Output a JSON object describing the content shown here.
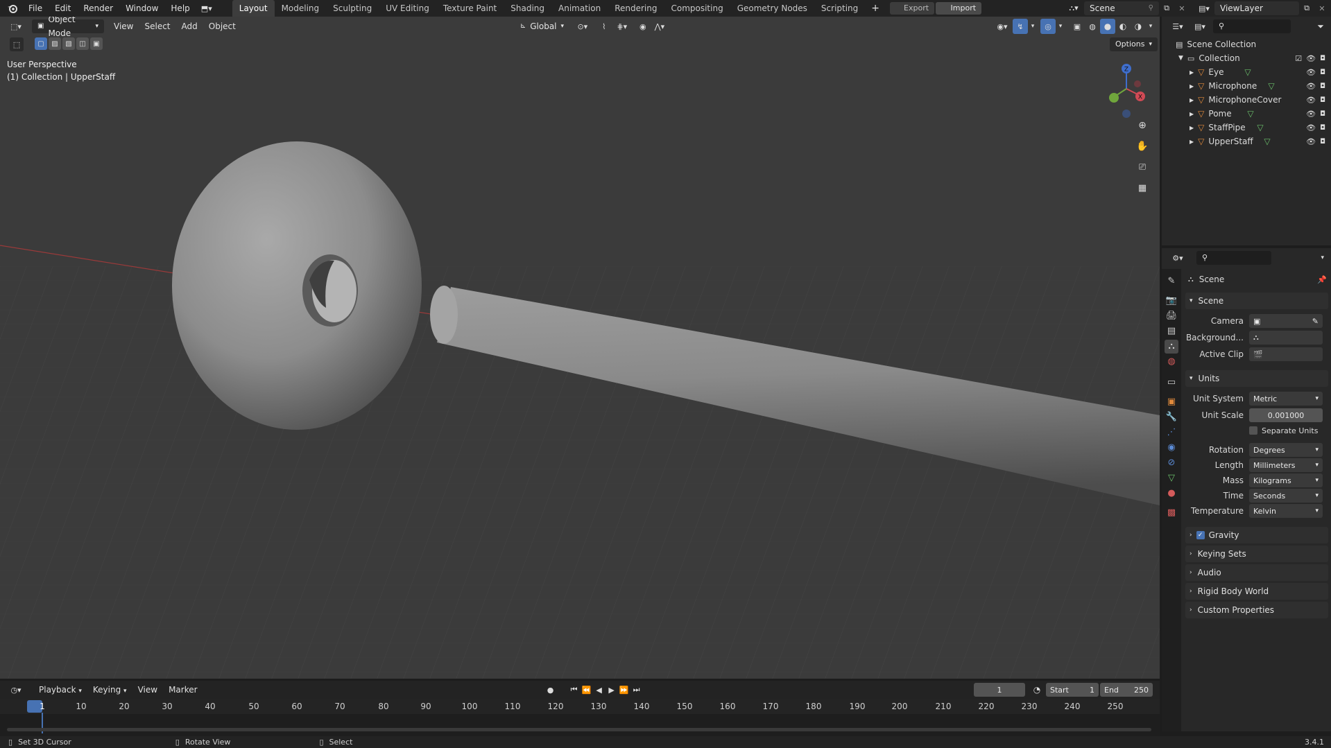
{
  "topbar": {
    "menus": [
      "File",
      "Edit",
      "Render",
      "Window",
      "Help"
    ],
    "workspaces": [
      "Layout",
      "Modeling",
      "Sculpting",
      "UV Editing",
      "Texture Paint",
      "Shading",
      "Animation",
      "Rendering",
      "Compositing",
      "Geometry Nodes",
      "Scripting"
    ],
    "active_workspace": "Layout",
    "add_workspace": "+",
    "export_label": "Export",
    "import_label": "Import",
    "scene_name": "Scene",
    "view_layer": "ViewLayer"
  },
  "viewport": {
    "mode": "Object Mode",
    "menus": [
      "View",
      "Select",
      "Add",
      "Object"
    ],
    "orientation": "Global",
    "options_label": "Options",
    "overlay_title": "User Perspective",
    "overlay_subtitle": "(1) Collection | UpperStaff",
    "gizmo_axes": {
      "z": "Z",
      "x": "X",
      "y": "Y"
    }
  },
  "outliner": {
    "root": "Scene Collection",
    "collection": "Collection",
    "objects": [
      "Eye",
      "Microphone",
      "MicrophoneCover",
      "Pome",
      "StaffPipe",
      "UpperStaff"
    ]
  },
  "properties": {
    "context": "Scene",
    "scene_section": "Scene",
    "camera_label": "Camera",
    "background_label": "Background...",
    "active_clip_label": "Active Clip",
    "units_section": "Units",
    "unit_system_label": "Unit System",
    "unit_system": "Metric",
    "unit_scale_label": "Unit Scale",
    "unit_scale": "0.001000",
    "separate_units": "Separate Units",
    "rotation_label": "Rotation",
    "rotation": "Degrees",
    "length_label": "Length",
    "length": "Millimeters",
    "mass_label": "Mass",
    "mass": "Kilograms",
    "time_label": "Time",
    "time": "Seconds",
    "temperature_label": "Temperature",
    "temperature": "Kelvin",
    "collapsed_sections": [
      "Gravity",
      "Keying Sets",
      "Audio",
      "Rigid Body World",
      "Custom Properties"
    ]
  },
  "timeline": {
    "menus": [
      "Playback",
      "Keying",
      "View",
      "Marker"
    ],
    "current_frame": "1",
    "start_label": "Start",
    "start": "1",
    "end_label": "End",
    "end": "250",
    "ruler": [
      "1",
      "10",
      "20",
      "30",
      "40",
      "50",
      "60",
      "70",
      "80",
      "90",
      "100",
      "110",
      "120",
      "130",
      "140",
      "150",
      "160",
      "170",
      "180",
      "190",
      "200",
      "210",
      "220",
      "230",
      "240",
      "250"
    ]
  },
  "statusbar": {
    "hint1": "Set 3D Cursor",
    "hint2": "Rotate View",
    "hint3": "Select",
    "version": "3.4.1"
  },
  "colors": {
    "accent": "#4772b3",
    "object_orange": "#e08a3c",
    "mesh_green": "#6bbf6b"
  }
}
